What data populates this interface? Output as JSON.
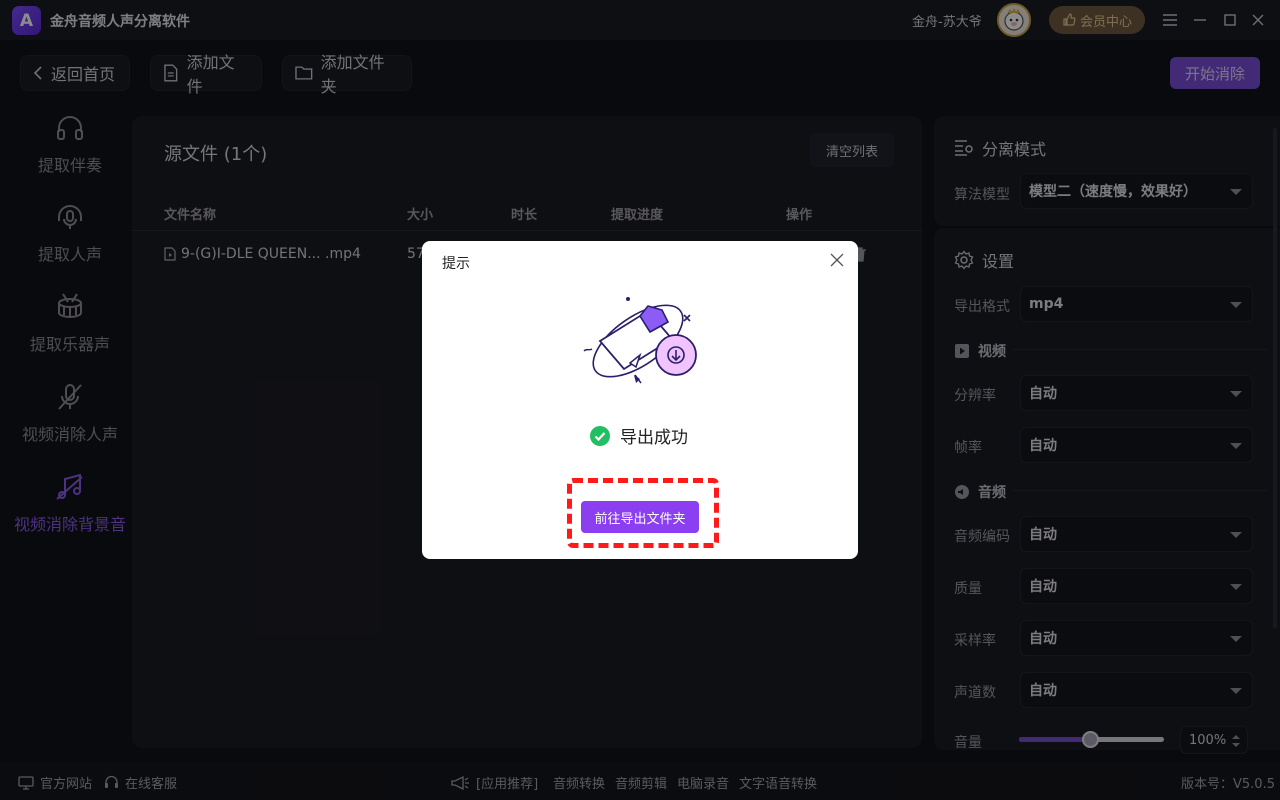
{
  "app": {
    "title": "金舟音频人声分离软件",
    "logo_letter": "A",
    "username": "金舟-苏大爷",
    "vip_label": "会员中心"
  },
  "toolbar": {
    "back": "返回首页",
    "add_file": "添加文件",
    "add_folder": "添加文件夹",
    "start": "开始消除"
  },
  "sidebar": {
    "items": [
      {
        "label": "提取伴奏",
        "icon": "headphones-icon"
      },
      {
        "label": "提取人声",
        "icon": "mic-headphones-icon"
      },
      {
        "label": "提取乐器声",
        "icon": "drum-icon"
      },
      {
        "label": "视频消除人声",
        "icon": "mic-off-icon"
      },
      {
        "label": "视频消除背景音",
        "icon": "music-off-icon",
        "active": true
      }
    ]
  },
  "file_panel": {
    "title": "源文件 (1个)",
    "clear_button": "清空列表",
    "columns": [
      "文件名称",
      "大小",
      "时长",
      "提取进度",
      "操作"
    ],
    "rows": [
      {
        "name": "9-(G)I-DLE QUEEN... .mp4",
        "size": "57"
      }
    ]
  },
  "separation": {
    "title": "分离模式",
    "model_label": "算法模型",
    "model_value": "模型二（速度慢，效果好）"
  },
  "settings": {
    "title": "设置",
    "format_label": "导出格式",
    "format_value": "mp4",
    "video_section": "视频",
    "resolution_label": "分辨率",
    "resolution_value": "自动",
    "framerate_label": "帧率",
    "framerate_value": "自动",
    "audio_section": "音频",
    "codec_label": "音频编码",
    "codec_value": "自动",
    "quality_label": "质量",
    "quality_value": "自动",
    "samplerate_label": "采样率",
    "samplerate_value": "自动",
    "channels_label": "声道数",
    "channels_value": "自动",
    "volume_label": "音量",
    "volume_value": "100%",
    "volume_slider_level": 0.49
  },
  "footer": {
    "website": "官方网站",
    "support": "在线客服",
    "recommend": "[应用推荐]",
    "links": [
      "音频转换",
      "音频剪辑",
      "电脑录音",
      "文字语音转换"
    ],
    "version": "版本号：V5.0.5"
  },
  "dialog": {
    "title": "提示",
    "message": "导出成功",
    "button": "前往导出文件夹"
  },
  "colors": {
    "accent": "#7b4ed8",
    "active_nav": "#8a5be8",
    "success": "#1fbf62",
    "highlight_border": "#ff1a1a"
  }
}
